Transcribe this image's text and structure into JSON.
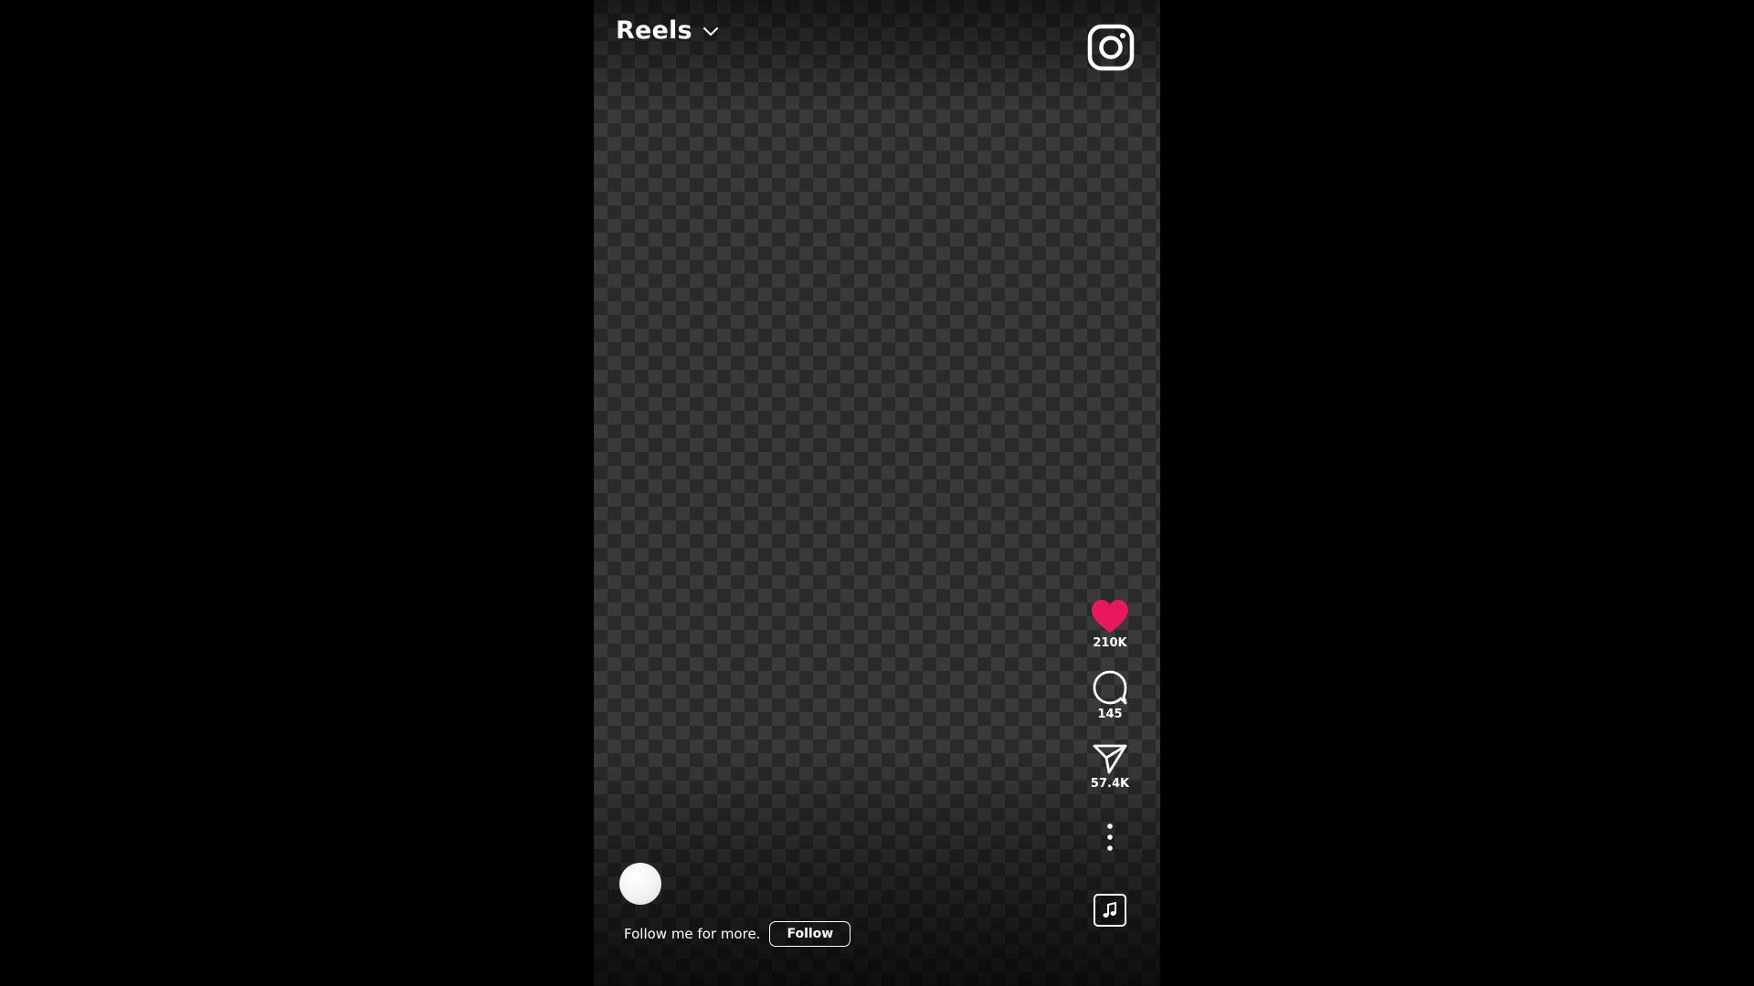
{
  "header": {
    "title": "Reels"
  },
  "actions": {
    "likes": "210K",
    "comments": "145",
    "shares": "57.4K"
  },
  "caption": {
    "text": "Follow me for more.",
    "follow_label": "Follow"
  },
  "colors": {
    "like_heart": "#e8185f",
    "background": "#000000"
  },
  "icons": [
    "chevron-down-icon",
    "instagram-logo-icon",
    "heart-icon",
    "comment-icon",
    "send-icon",
    "more-vertical-icon",
    "music-note-icon"
  ]
}
